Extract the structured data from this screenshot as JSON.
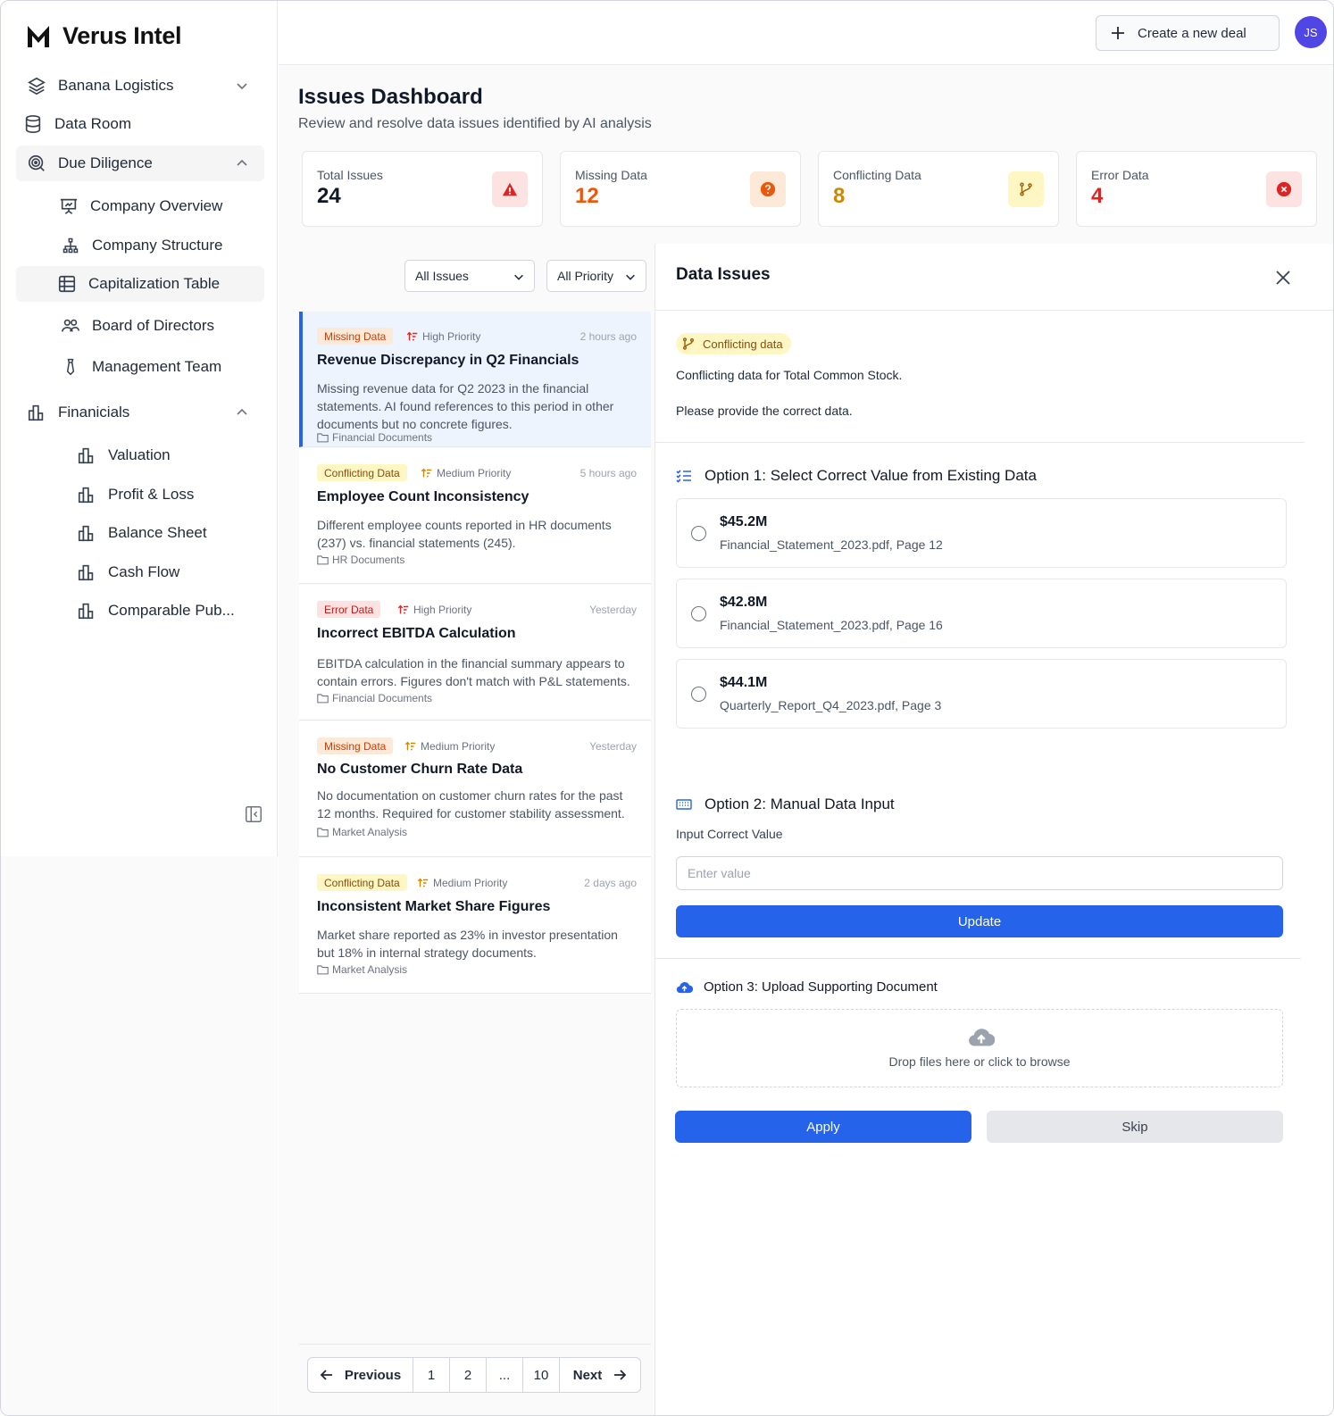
{
  "app": {
    "name": "Verus Intel"
  },
  "sidebar": {
    "company": "Banana Logistics",
    "data_room": "Data Room",
    "due_diligence": {
      "label": "Due Diligence",
      "items": [
        "Company Overview",
        "Company Structure",
        "Capitalization Table",
        "Board of Directors",
        "Management Team"
      ]
    },
    "financials": {
      "label": "Finanicials",
      "items": [
        "Valuation",
        "Profit & Loss",
        "Balance Sheet",
        "Cash Flow",
        "Comparable Pub..."
      ]
    }
  },
  "header": {
    "create_label": "Create a new deal",
    "avatar_initials": "JS"
  },
  "page": {
    "title": "Issues Dashboard",
    "subtitle": "Review and resolve data issues identified by AI analysis"
  },
  "stats": [
    {
      "label": "Total Issues",
      "value": "24",
      "color": "#111827",
      "icon": "warning-triangle-icon",
      "icon_bg": "#fde2e2",
      "icon_color": "#dc2626"
    },
    {
      "label": "Missing Data",
      "value": "12",
      "color": "#ea580c",
      "icon": "question-circle-icon",
      "icon_bg": "#fde9d7",
      "icon_color": "#ea580c"
    },
    {
      "label": "Conflicting Data",
      "value": "8",
      "color": "#ca8a04",
      "icon": "git-branch-icon",
      "icon_bg": "#fef7c3",
      "icon_color": "#a16207"
    },
    {
      "label": "Error Data",
      "value": "4",
      "color": "#dc2626",
      "icon": "x-circle-icon",
      "icon_bg": "#fde2e2",
      "icon_color": "#dc2626"
    }
  ],
  "filters": {
    "type": "All Issues",
    "priority": "All Priority"
  },
  "issues": [
    {
      "tag": "Missing Data",
      "tag_kind": "missing",
      "priority": "High Priority",
      "priority_color": "#dc2626",
      "time": "2 hours ago",
      "title": "Revenue Discrepancy in Q2 Financials",
      "desc": "Missing revenue data for Q2 2023 in the financial statements. AI found references to this period in other documents but no concrete figures.",
      "source": "Financial Documents"
    },
    {
      "tag": "Conflicting Data",
      "tag_kind": "conflict",
      "priority": "Medium Priority",
      "priority_color": "#ca8a04",
      "time": "5 hours ago",
      "title": "Employee Count Inconsistency",
      "desc": "Different employee counts reported in HR documents (237) vs. financial statements (245).",
      "source": "HR Documents"
    },
    {
      "tag": "Error Data",
      "tag_kind": "error",
      "priority": "High Priority",
      "priority_color": "#dc2626",
      "time": "Yesterday",
      "title": "Incorrect EBITDA Calculation",
      "desc": "EBITDA calculation in the financial summary appears to contain errors. Figures don't match with P&L statements.",
      "source": "Financial Documents"
    },
    {
      "tag": "Missing Data",
      "tag_kind": "missing",
      "priority": "Medium Priority",
      "priority_color": "#ca8a04",
      "time": "Yesterday",
      "title": "No Customer Churn Rate Data",
      "desc": "No documentation on customer churn rates for the past 12 months. Required for customer stability assessment.",
      "source": "Market Analysis"
    },
    {
      "tag": "Conflicting Data",
      "tag_kind": "conflict",
      "priority": "Medium Priority",
      "priority_color": "#ca8a04",
      "time": "2 days ago",
      "title": "Inconsistent Market Share Figures",
      "desc": "Market share reported as 23% in investor presentation but 18% in internal strategy documents.",
      "source": "Market Analysis"
    }
  ],
  "pagination": {
    "prev": "Previous",
    "pages": [
      "1",
      "2",
      "...",
      "10"
    ],
    "next": "Next"
  },
  "detail": {
    "title": "Data Issues",
    "tag": "Conflicting data",
    "line1": "Conflicting data for Total Common Stock.",
    "line2": "Please provide the correct data.",
    "option1": {
      "title": "Option 1: Select Correct Value from Existing Data",
      "choices": [
        {
          "value": "$45.2M",
          "source": "Financial_Statement_2023.pdf, Page 12"
        },
        {
          "value": "$42.8M",
          "source": "Financial_Statement_2023.pdf, Page 16"
        },
        {
          "value": "$44.1M",
          "source": "Quarterly_Report_Q4_2023.pdf, Page 3"
        }
      ]
    },
    "option2": {
      "title": "Option 2: Manual Data Input",
      "input_label": "Input Correct Value",
      "placeholder": "Enter value",
      "update": "Update"
    },
    "option3": {
      "title": "Option 3: Upload Supporting Document",
      "drop_text": "Drop files here or click to browse"
    },
    "apply": "Apply",
    "skip": "Skip"
  }
}
